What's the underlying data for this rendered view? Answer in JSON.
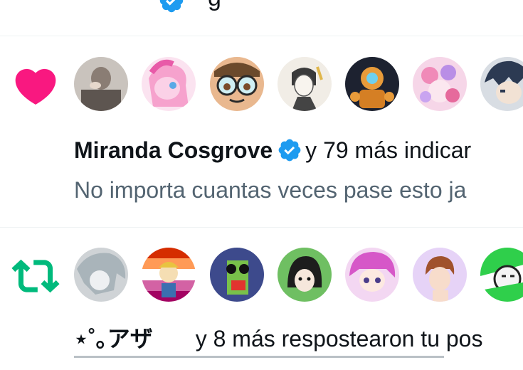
{
  "top_partial": {
    "tail_text": "g"
  },
  "like_notification": {
    "icon": "heart-icon",
    "icon_color": "#f91880",
    "user_name": "Miranda Cosgrove",
    "verified": true,
    "rest_text": "y 79 más indicar",
    "preview_text": "No importa cuantas veces pase esto ja",
    "avatars": [
      "avatar-1",
      "avatar-2",
      "avatar-3",
      "avatar-4",
      "avatar-5",
      "avatar-6",
      "avatar-7"
    ]
  },
  "repost_notification": {
    "icon": "repost-icon",
    "icon_color": "#00ba7c",
    "user_name": "⋆˚｡アザ",
    "rest_text": "y 8 más respostearon tu pos",
    "avatars": [
      "avatar-1",
      "avatar-2",
      "avatar-3",
      "avatar-4",
      "avatar-5",
      "avatar-6",
      "avatar-7"
    ]
  },
  "colors": {
    "verified_blue": "#1d9bf0",
    "divider": "#eff3f4",
    "secondary_text": "#536471"
  }
}
